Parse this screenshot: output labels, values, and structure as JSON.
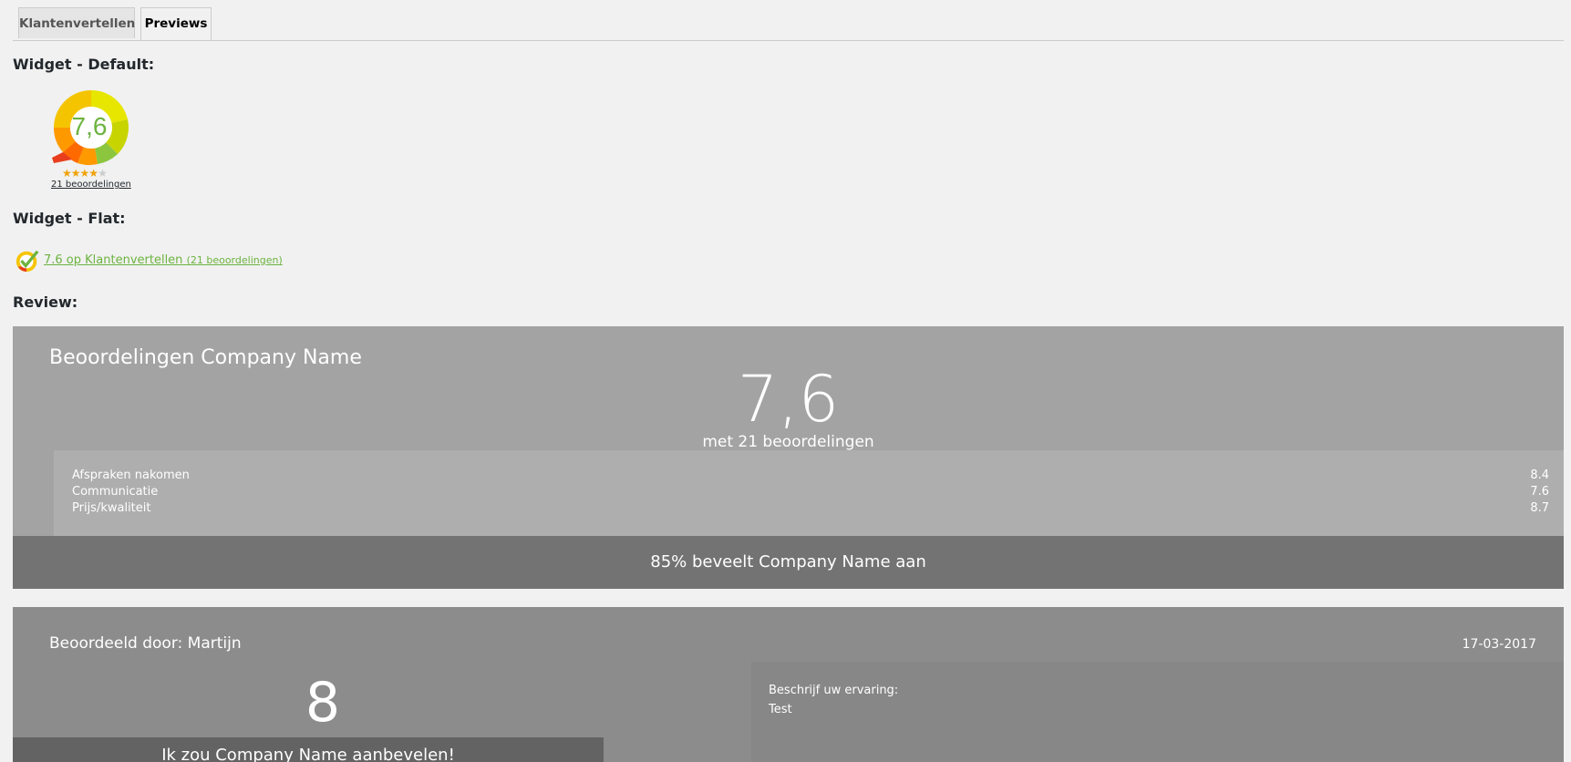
{
  "tabs": [
    "Klantenvertellen",
    "Previews"
  ],
  "sections": {
    "default_title": "Widget - Default:",
    "flat_title": "Widget - Flat:",
    "review_title": "Review:"
  },
  "widget_default": {
    "score": "7,6",
    "stars_rating": 4,
    "stars_total": 5,
    "count_text": "21 beoordelingen"
  },
  "widget_flat": {
    "link_text": "7.6 op Klantenvertellen",
    "count_text": "(21 beoordelingen)"
  },
  "review": {
    "title": "Beoordelingen Company Name",
    "score": "7,6",
    "subtitle": "met 21 beoordelingen",
    "criteria": [
      {
        "label": "Afspraken nakomen",
        "value": "8.4"
      },
      {
        "label": "Communicatie",
        "value": "7.6"
      },
      {
        "label": "Prijs/kwaliteit",
        "value": "8.7"
      }
    ],
    "recommend": "85% beveelt Company Name aan"
  },
  "single_review": {
    "by": "Beoordeeld door: Martijn",
    "date": "17-03-2017",
    "score": "8",
    "recommend": "Ik zou Company Name aanbevelen!",
    "experience_label": "Beschrijf uw ervaring:",
    "experience_text": "Test"
  },
  "colors": {
    "accent_green": "#6cb33f",
    "star": "#f0a30a",
    "review_bg": "#a3a3a3",
    "recommend_bg": "#737373"
  }
}
